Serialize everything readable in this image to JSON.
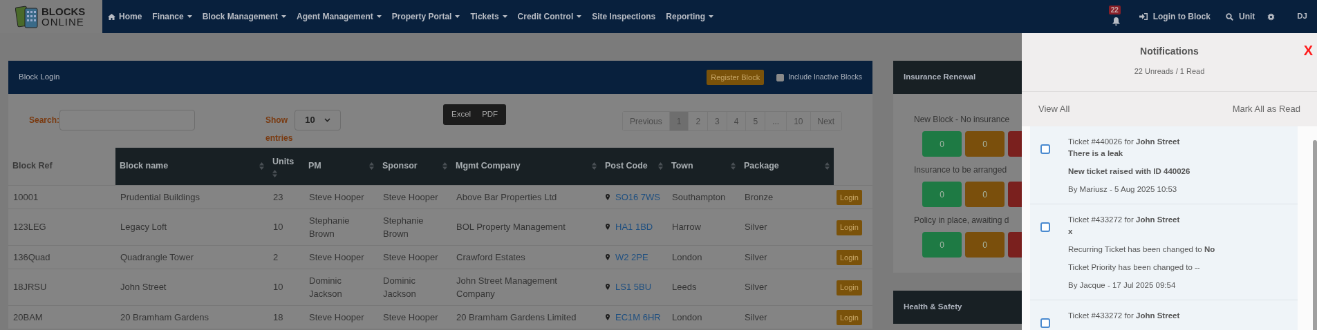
{
  "nav": {
    "logo": {
      "line1": "BLOCKS",
      "line2": "ONLINE"
    },
    "menu": [
      {
        "label": "Home",
        "dropdown": false
      },
      {
        "label": "Finance",
        "dropdown": true
      },
      {
        "label": "Block Management",
        "dropdown": true
      },
      {
        "label": "Agent Management",
        "dropdown": true
      },
      {
        "label": "Property Portal",
        "dropdown": true
      },
      {
        "label": "Tickets",
        "dropdown": true
      },
      {
        "label": "Credit Control",
        "dropdown": true
      },
      {
        "label": "Site Inspections",
        "dropdown": false
      },
      {
        "label": "Reporting",
        "dropdown": true
      }
    ],
    "notification_badge": "22",
    "actions": [
      {
        "label": "Login to Block"
      },
      {
        "label": "Unit"
      }
    ],
    "user": "DJ"
  },
  "block_login": {
    "title": "Block Login",
    "register_button": "Register Block",
    "include_inactive": {
      "label": "Include Inactive Blocks",
      "checked": false
    },
    "search_label": "Search:",
    "show_label": "Show",
    "page_size": "10",
    "entries_label": "entries",
    "export_buttons": [
      "Excel",
      "PDF"
    ],
    "pagination": [
      {
        "label": "Previous",
        "selected": false
      },
      {
        "label": "1",
        "selected": true
      },
      {
        "label": "2",
        "selected": false
      },
      {
        "label": "3",
        "selected": false
      },
      {
        "label": "4",
        "selected": false
      },
      {
        "label": "5",
        "selected": false
      },
      {
        "label": "...",
        "selected": false
      },
      {
        "label": "10",
        "selected": false
      },
      {
        "label": "Next",
        "selected": false
      }
    ],
    "columns": [
      {
        "label": "Block Ref",
        "sortable": false
      },
      {
        "label": "Block name",
        "sortable": true
      },
      {
        "label": "Units",
        "sortable": true
      },
      {
        "label": "PM",
        "sortable": true
      },
      {
        "label": "Sponsor",
        "sortable": true
      },
      {
        "label": "Mgmt Company",
        "sortable": true
      },
      {
        "label": "Post Code",
        "sortable": true
      },
      {
        "label": "Town",
        "sortable": true
      },
      {
        "label": "Package",
        "sortable": true
      }
    ],
    "rows": [
      {
        "cells": [
          "10001",
          "Prudential Buildings",
          "23",
          "Steve Hooper",
          "Steve Hooper",
          "Above Bar Properties Ltd",
          "SO16 7WS",
          "Southampton",
          "Bronze"
        ],
        "login": "Login"
      },
      {
        "cells": [
          "123LEG",
          "Legacy Loft",
          "10",
          "Stephanie Brown",
          "Stephanie Brown",
          "BOL Property Management",
          "HA1 1BD",
          "Harrow",
          "Silver"
        ],
        "login": "Login"
      },
      {
        "cells": [
          "136Quad",
          "Quadrangle Tower",
          "2",
          "Steve Hooper",
          "Steve Hooper",
          "Crawford Estates",
          "W2 2PE",
          "London",
          "Silver"
        ],
        "login": "Login"
      },
      {
        "cells": [
          "18JRSU",
          "John Street",
          "10",
          "Dominic Jackson",
          "Dominic Jackson",
          "John Street Management Company",
          "LS1 5BU",
          "Leeds",
          "Silver"
        ],
        "login": "Login"
      },
      {
        "cells": [
          "20BAM",
          "20 Bramham Gardens",
          "18",
          "Steve Hooper",
          "Steve Hooper",
          "20 Bramham Gardens Limited",
          "EC1M 6HR",
          "London",
          "Silver"
        ],
        "login": "Login"
      }
    ]
  },
  "insurance_renewal": {
    "title": "Insurance Renewal",
    "groups": [
      {
        "label": "New Block - No insurance",
        "counters": [
          {
            "value": "0",
            "color": "#1e7a44"
          },
          {
            "value": "0",
            "color": "#7a4f0c"
          },
          {
            "color": "#7a201e"
          }
        ]
      },
      {
        "label": "Insurance to be arranged",
        "counters": [
          {
            "value": "0",
            "color": "#1e7a44"
          },
          {
            "value": "0",
            "color": "#7a4f0c"
          },
          {
            "color": "#7a201e"
          }
        ]
      },
      {
        "label": "Policy in place, awaiting d",
        "counters": [
          {
            "value": "0",
            "color": "#1e7a44"
          },
          {
            "value": "0",
            "color": "#7a4f0c"
          },
          {
            "color": "#7a201e"
          }
        ]
      }
    ]
  },
  "health_safety": {
    "title": "Health & Safety"
  },
  "notifications": {
    "title": "Notifications",
    "summary": "22 Unreads / 1 Read",
    "close": "X",
    "view_all": "View All",
    "mark_all": "Mark All as Read",
    "items": [
      {
        "checked": false,
        "header": "Ticket #440026 for **John Street**",
        "subject": "There is a leak",
        "lines": [
          {
            "text": "New ticket raised with ID 440026",
            "bold": true
          }
        ],
        "by": "By Mariusz - 5 Aug 2025 10:53"
      },
      {
        "checked": false,
        "header": "Ticket #433272 for **John Street**",
        "subject": "x",
        "lines": [
          {
            "text": "Recurring Ticket has been changed to **No**",
            "bold": false
          },
          {
            "text": "Ticket Priority has been changed to --",
            "bold": false
          }
        ],
        "by": "By Jacque - 17 Jul 2025 09:54"
      },
      {
        "checked": false,
        "header": "Ticket #433272 for **John Street**"
      }
    ]
  }
}
